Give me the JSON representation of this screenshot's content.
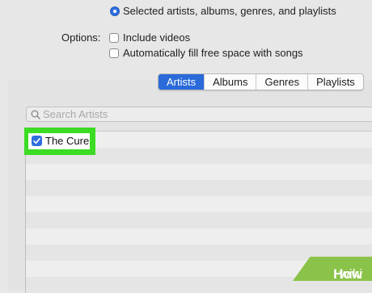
{
  "sync_options": {
    "selected_radio_label": "Selected artists, albums, genres, and playlists"
  },
  "options": {
    "heading": "Options:",
    "include_videos_label": "Include videos",
    "autofill_label": "Automatically fill free space with songs"
  },
  "tabs": [
    {
      "label": "Artists",
      "active": true
    },
    {
      "label": "Albums",
      "active": false
    },
    {
      "label": "Genres",
      "active": false
    },
    {
      "label": "Playlists",
      "active": false
    }
  ],
  "search": {
    "placeholder": "Search Artists"
  },
  "artists": [
    {
      "name": "The Cure",
      "checked": true
    }
  ],
  "watermark": {
    "brand_light": "wiki",
    "brand_bold": "How"
  },
  "colors": {
    "accent": "#2a6ad9",
    "highlight": "#3cdb24",
    "watermark": "#8bc34a"
  },
  "icons": {
    "search": "magnifier-icon",
    "check": "checkmark-icon"
  }
}
